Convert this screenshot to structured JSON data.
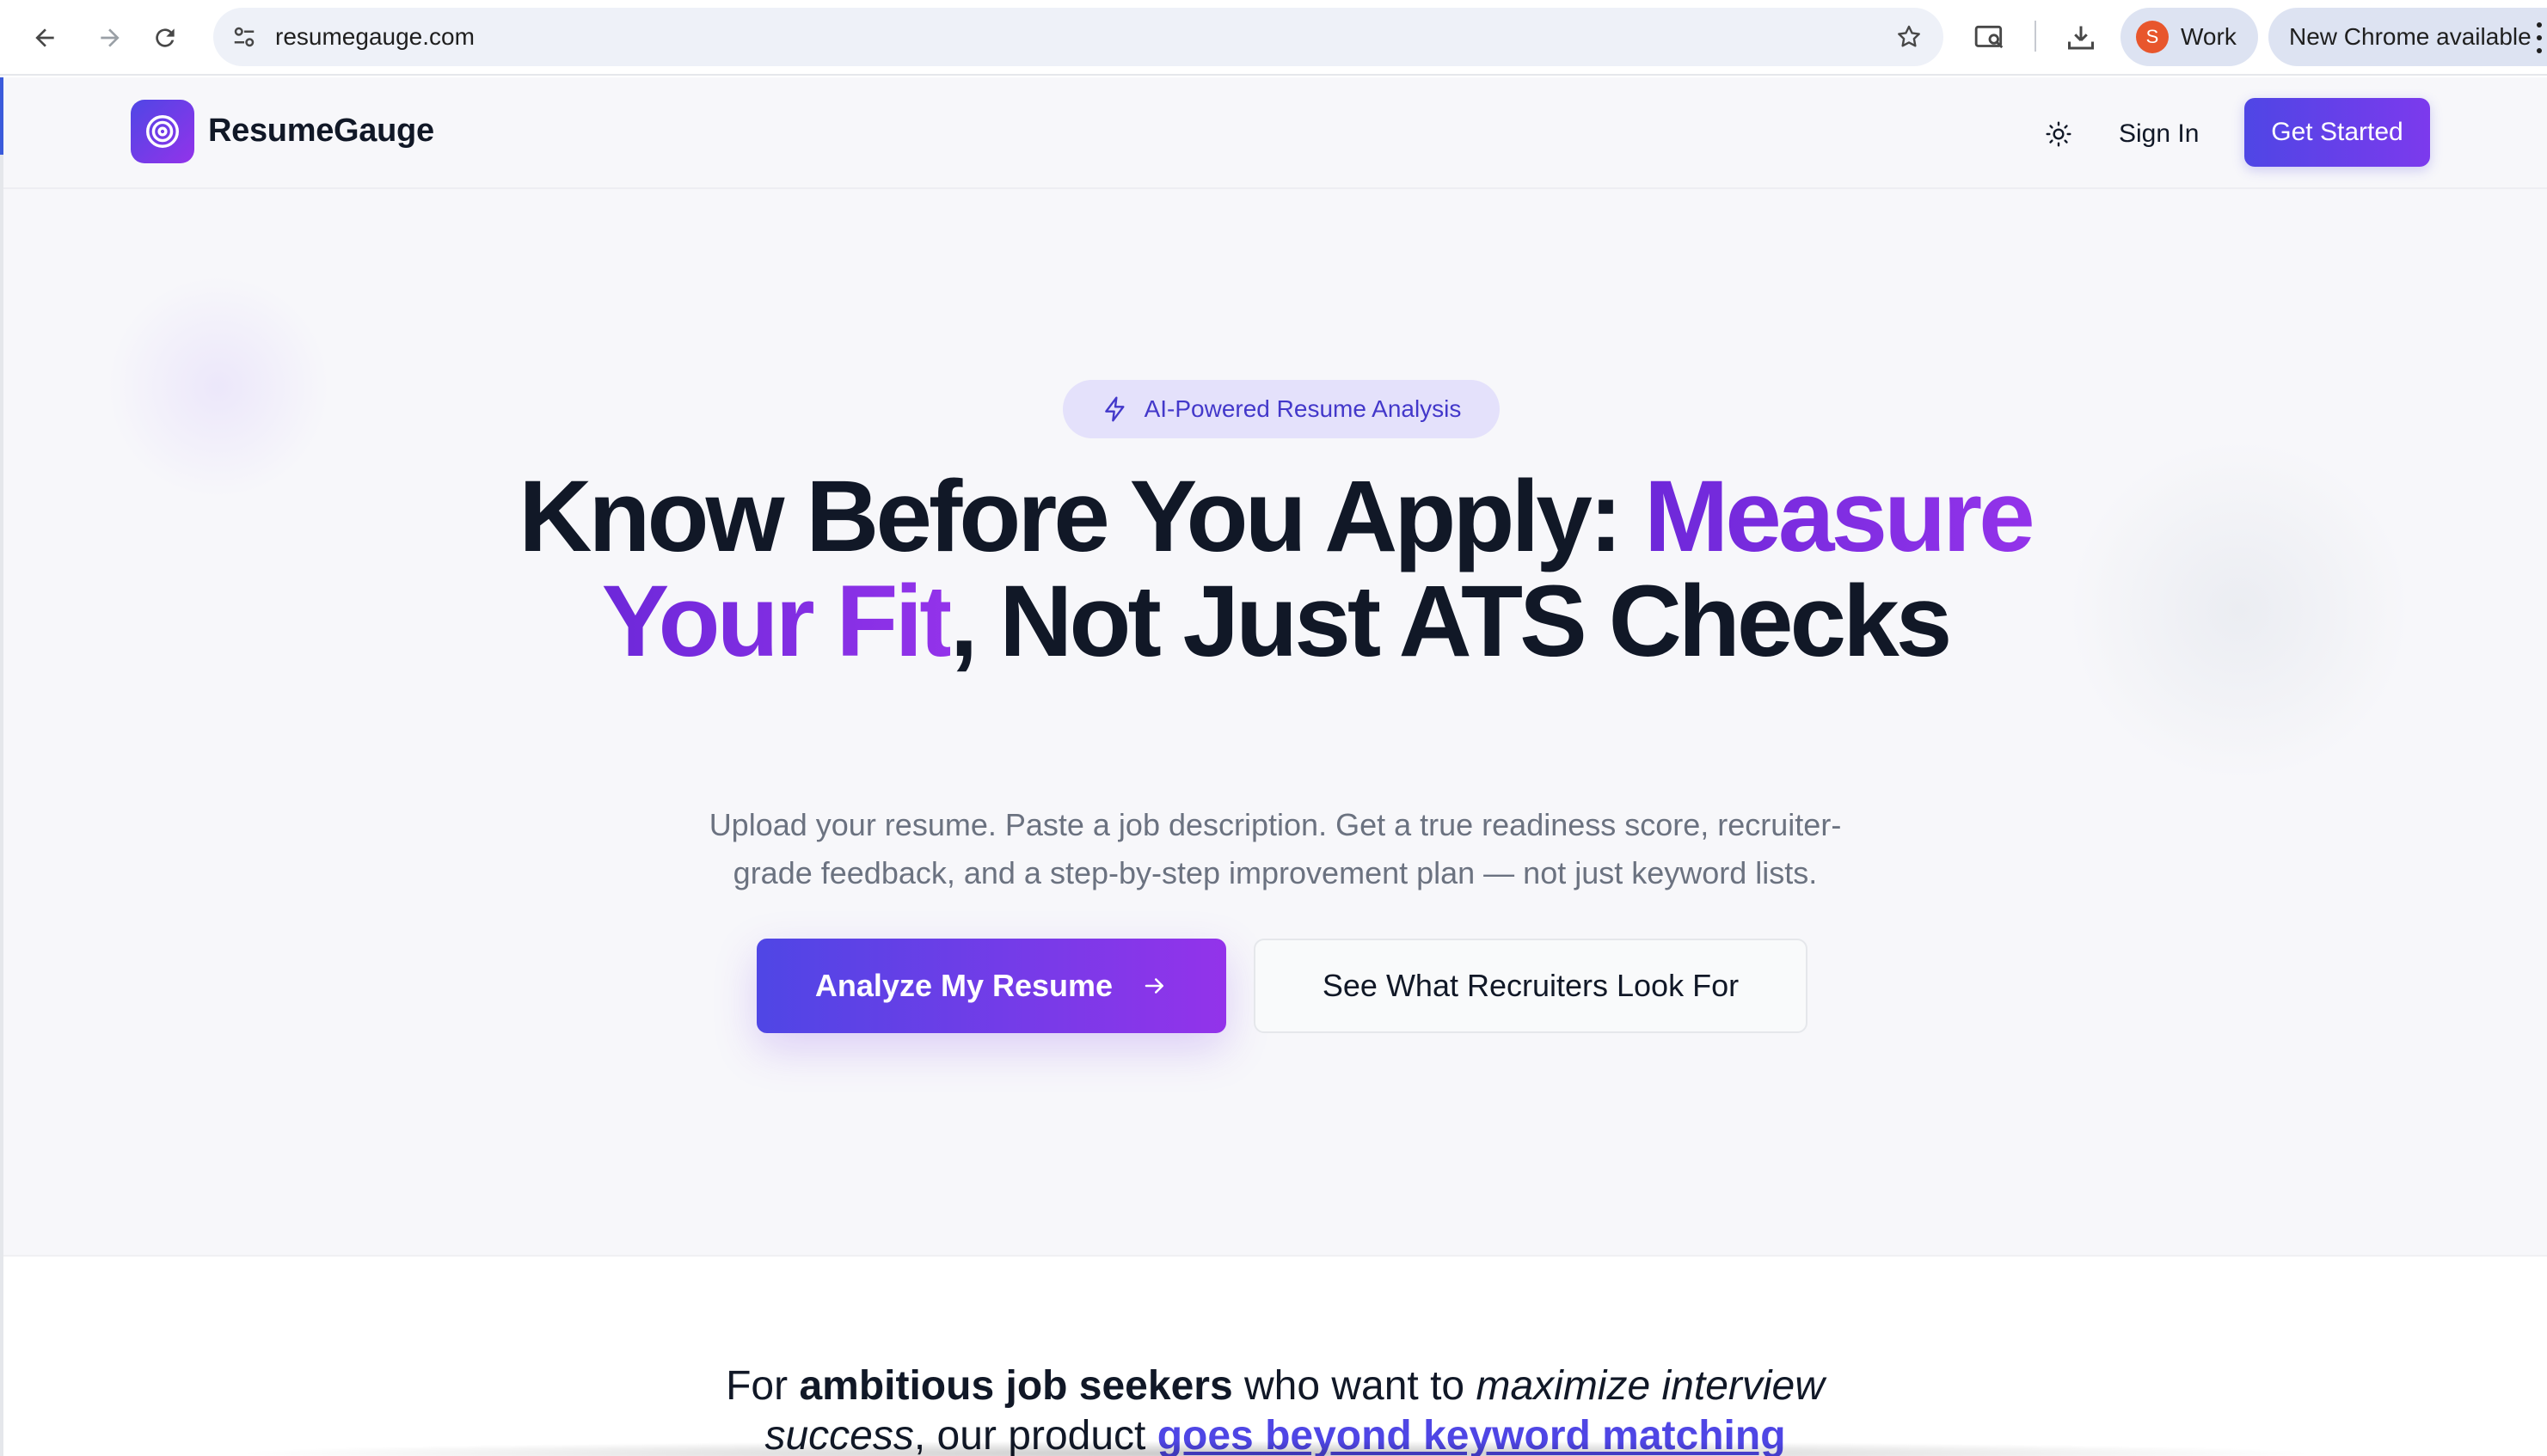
{
  "browser": {
    "url": "resumegauge.com",
    "profile_initial": "S",
    "profile_name": "Work",
    "update_label": "New Chrome available",
    "icons": [
      "back-arrow-icon",
      "forward-arrow-icon",
      "reload-icon",
      "site-settings-icon",
      "bookmark-star-icon",
      "tab-search-icon",
      "download-icon",
      "more-menu-icon"
    ]
  },
  "header": {
    "brand": "ResumeGauge",
    "sign_in": "Sign In",
    "get_started": "Get Started"
  },
  "hero": {
    "badge": "AI-Powered Resume Analysis",
    "headline_part1": "Know Before You Apply: ",
    "headline_highlight1": "Measure",
    "headline_highlight2": "Your Fit",
    "headline_part2": ", Not Just ATS Checks",
    "subtext": "Upload your resume. Paste a job description. Get a true readiness score, recruiter-grade feedback, and a step-by-step improvement plan — not just keyword lists.",
    "cta_primary": "Analyze My Resume",
    "cta_secondary": "See What Recruiters Look For"
  },
  "tagline": {
    "t1": "For ",
    "t2": "ambitious job seekers",
    "t3": " who want to ",
    "t4": "maximize interview success",
    "t5": ", our product ",
    "t6": "goes beyond keyword matching"
  },
  "colors": {
    "brand_gradient_start": "#4f46e5",
    "brand_gradient_end": "#9333ea",
    "badge_bg": "#e4e1fb",
    "page_bg": "#f7f7fa",
    "profile_avatar": "#e8562c"
  }
}
